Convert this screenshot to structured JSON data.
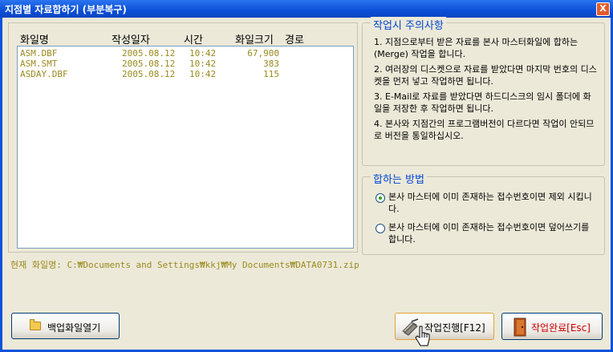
{
  "window": {
    "title": "지점별 자료합하기 (부분복구)",
    "close_label": "X"
  },
  "files": {
    "headers": {
      "name": "화일명",
      "date": "작성일자",
      "time": "시간",
      "size": "화일크기",
      "path": "경로"
    },
    "rows": [
      {
        "name": "ASM.DBF",
        "date": "2005.08.12",
        "time": "10:42",
        "size": "67,900"
      },
      {
        "name": "ASM.SMT",
        "date": "2005.08.12",
        "time": "10:42",
        "size": "383"
      },
      {
        "name": "ASDAY.DBF",
        "date": "2005.08.12",
        "time": "10:42",
        "size": "115"
      }
    ]
  },
  "notes": {
    "legend": "작업시 주의사항",
    "items": [
      "1. 지점으로부터 받은 자료를 본사 마스터화일에 합하는(Merge) 작업을 합니다.",
      "2. 여러장의 디스켓으로 자료를 받았다면 마지막 번호의 디스켓을 먼저 넣고 작업하면 됩니다.",
      "3. E-Mail로 자료를 받았다면 하드디스크의 임시 폴더에 화일을 저장한 후 작업하면 됩니다.",
      "4. 본사와 지점간의 프로그램버전이 다르다면 작업이 안되므로 버전을 통일하십시오."
    ]
  },
  "merge": {
    "legend": "합하는 방법",
    "options": [
      {
        "label": "본사 마스터에 이미 존재하는 접수번호이면 제외 시킵니다.",
        "checked": true
      },
      {
        "label": "본사 마스터에 이미 존재하는 접수번호이면 덮어쓰기를 합니다.",
        "checked": false
      }
    ]
  },
  "current_file": "현재 화일명: C:₩Documents and Settings₩kkj₩My Documents₩DATA0731.zip",
  "buttons": {
    "open_backup": "백업화일열기",
    "run": "작업진행[F12]",
    "finish": "작업완료[Esc]"
  },
  "colors": {
    "title_bar": "#0b4fd6",
    "list_text": "#9b8a1f",
    "legend_text": "#0046d5",
    "finish_text": "#cc0000"
  },
  "icons": {
    "open_backup": "folder-icon",
    "run": "run-icon",
    "finish": "exit-door-icon",
    "cursor": "hand-cursor-icon"
  }
}
